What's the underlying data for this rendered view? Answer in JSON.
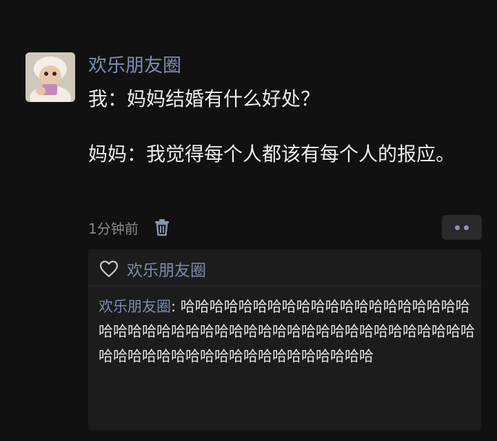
{
  "post": {
    "poster_name": "欢乐朋友圈",
    "text_line1": "我：妈妈结婚有什么好处？",
    "text_line2": "妈妈：我觉得每个人都该有每个人的报应。",
    "time": "1分钟前",
    "avatar_icon": "baby-avatar-photo",
    "delete_icon": "trash-icon",
    "more_icon": "more-dots-icon"
  },
  "likes": {
    "icon": "heart-icon",
    "name": "欢乐朋友圈"
  },
  "comments": [
    {
      "author": "欢乐朋友圈",
      "separator": ": ",
      "text": "哈哈哈哈哈哈哈哈哈哈哈哈哈哈哈哈哈哈哈哈哈哈哈哈哈哈哈哈哈哈哈哈哈哈哈哈哈哈哈哈哈哈哈哈哈哈哈哈哈哈哈哈哈哈哈哈哈哈哈哈哈哈哈哈哈"
    }
  ],
  "colors": {
    "background": "#111111",
    "name_link": "#7d8bb0",
    "comment_panel": "#1c1c1c",
    "meta_text": "#8a8a8a"
  }
}
